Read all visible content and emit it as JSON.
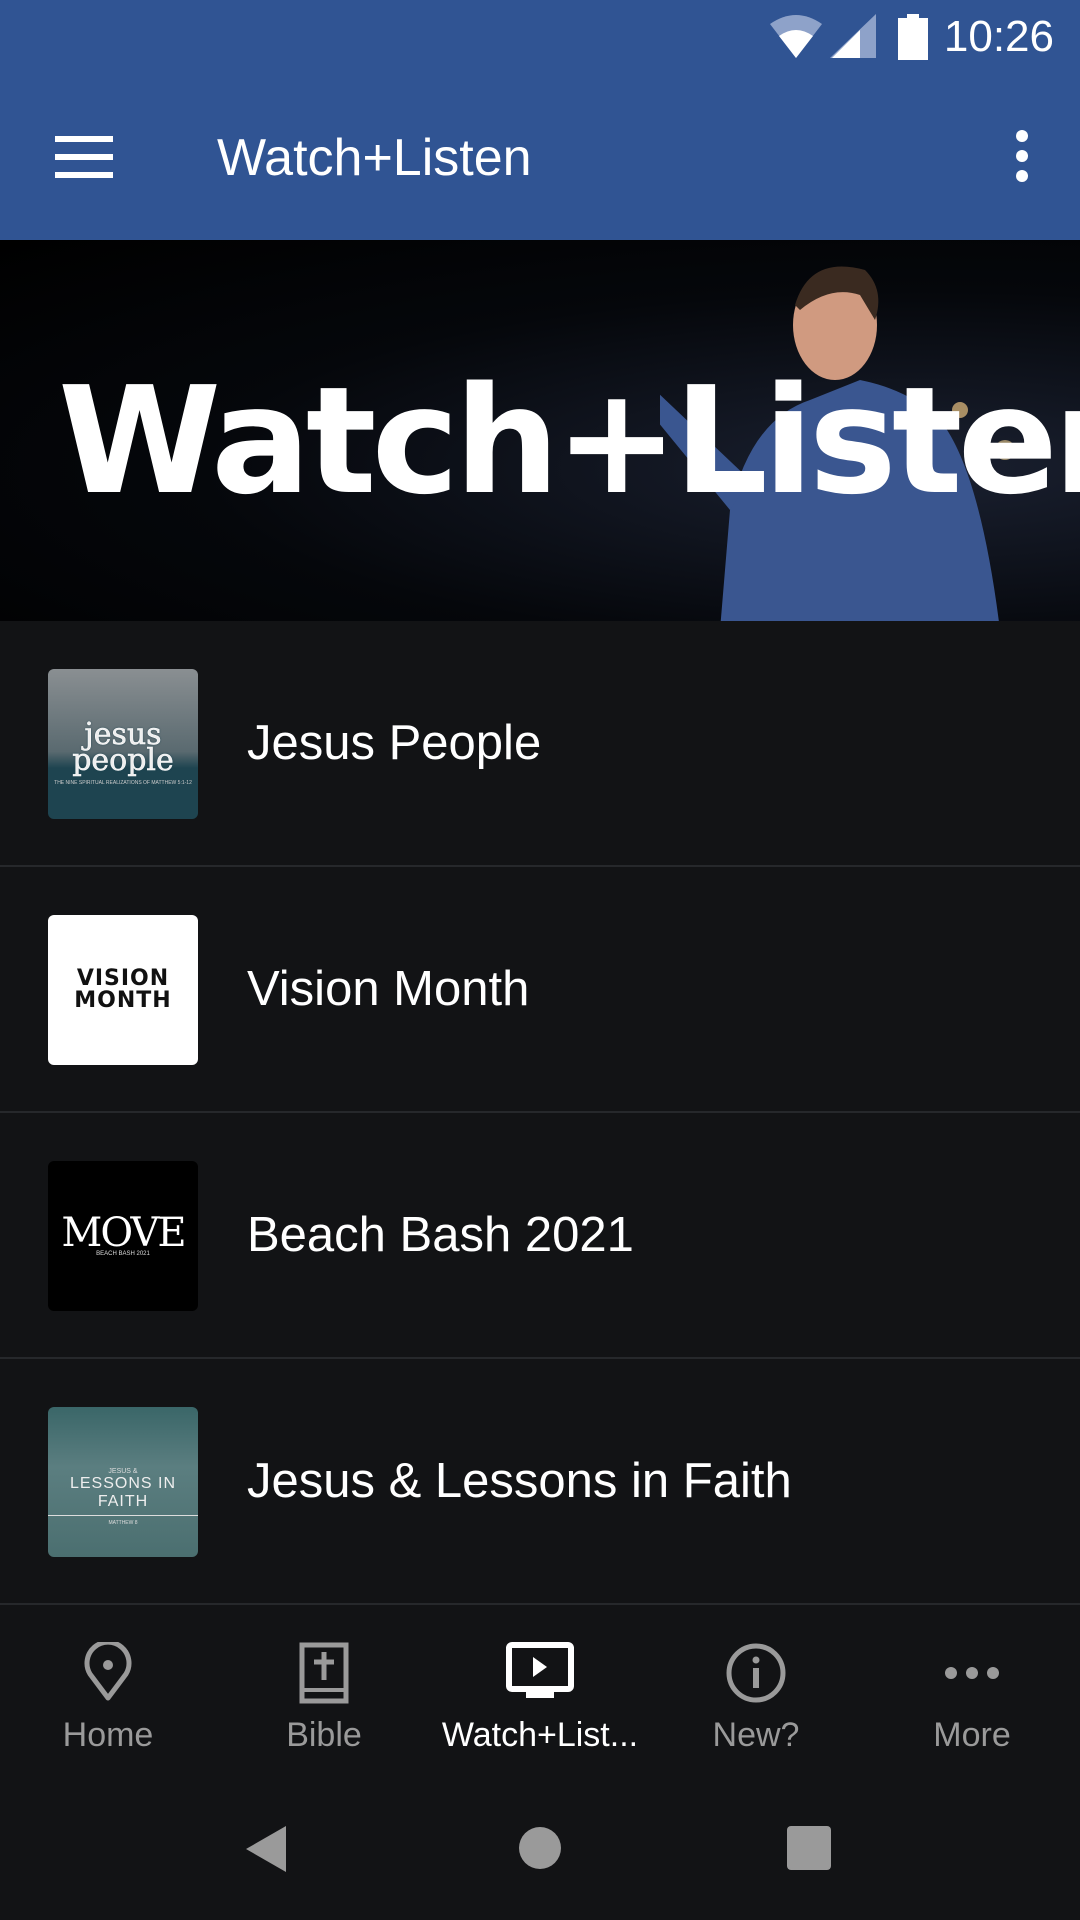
{
  "status_bar": {
    "time": "10:26",
    "icons": [
      "wifi-icon",
      "signal-icon",
      "battery-icon"
    ]
  },
  "app_bar": {
    "title": "Watch+Listen",
    "menu_icon": "hamburger-icon",
    "overflow_icon": "more-vert-icon"
  },
  "banner": {
    "text": "Watch+Listen"
  },
  "series": [
    {
      "title": "Jesus People",
      "thumb_text": "jesus people",
      "thumb_sub": "THE NINE SPIRITUAL REALIZATIONS OF MATTHEW 5:1-12"
    },
    {
      "title": "Vision Month",
      "thumb_text": "VISION MONTH"
    },
    {
      "title": "Beach Bash 2021",
      "thumb_text": "MOVE",
      "thumb_sub": "BEACH BASH 2021"
    },
    {
      "title": "Jesus & Lessons in Faith",
      "thumb_pre": "JESUS &",
      "thumb_text": "LESSONS IN FAITH",
      "thumb_sub": "MATTHEW 8"
    }
  ],
  "bottom_nav": {
    "items": [
      {
        "label": "Home",
        "icon": "location-pin-icon"
      },
      {
        "label": "Bible",
        "icon": "bible-icon"
      },
      {
        "label": "Watch+List...",
        "icon": "tv-play-icon",
        "active": true
      },
      {
        "label": "New?",
        "icon": "info-icon"
      },
      {
        "label": "More",
        "icon": "more-horiz-icon"
      }
    ]
  },
  "colors": {
    "app_bar": "#305493",
    "background": "#121315",
    "inactive": "#9a9a9a",
    "active": "#ffffff"
  }
}
